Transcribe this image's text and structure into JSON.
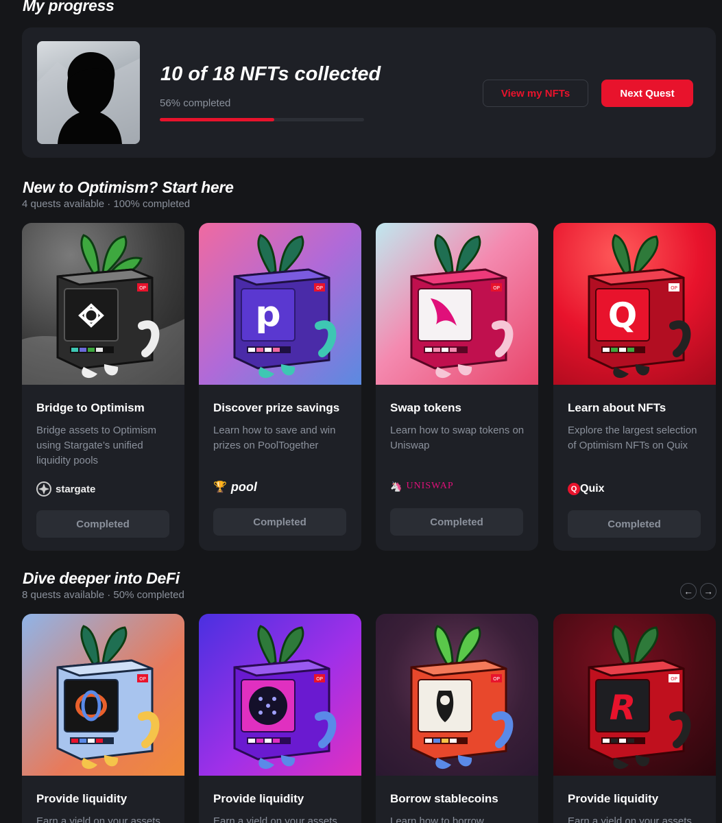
{
  "progress": {
    "heading": "My progress",
    "title": "10 of 18 NFTs collected",
    "completed_label": "56% completed",
    "percent": 0.56,
    "view_button": "View my NFTs",
    "next_button": "Next Quest"
  },
  "section1": {
    "heading": "New to Optimism? Start here",
    "subtitle": "4 quests available · 100% completed",
    "cards": [
      {
        "title": "Bridge to Optimism",
        "desc": "Bridge assets to Optimism using Stargate’s unified liquidity pools",
        "brand": "stargate",
        "button": "Completed",
        "screen": "compass"
      },
      {
        "title": "Discover prize savings",
        "desc": "Learn how to save and win prizes on PoolTogether",
        "brand": "pool",
        "button": "Completed",
        "screen": "p"
      },
      {
        "title": "Swap tokens",
        "desc": "Learn how to swap tokens on Uniswap",
        "brand": "UNISWAP",
        "button": "Completed",
        "screen": "unicorn"
      },
      {
        "title": "Learn about NFTs",
        "desc": "Explore the largest selection of Optimism NFTs on Quix",
        "brand": "Quix",
        "button": "Completed",
        "screen": "Q"
      }
    ]
  },
  "section2": {
    "heading": "Dive deeper into DeFi",
    "subtitle": "8 quests available · 50% completed",
    "prev_icon": "←",
    "next_icon": "→",
    "cards": [
      {
        "title": "Provide liquidity",
        "desc": "Earn a yield on your assets",
        "screen": "loop"
      },
      {
        "title": "Provide liquidity",
        "desc": "Earn a yield on your assets",
        "screen": "circle"
      },
      {
        "title": "Borrow stablecoins",
        "desc": "Learn how to borrow",
        "screen": "face"
      },
      {
        "title": "Provide liquidity",
        "desc": "Earn a yield on your assets",
        "screen": "R"
      }
    ]
  },
  "robot_badge": "OP",
  "colors": {
    "accent": "#e8132c",
    "card": "#1e2026",
    "bg": "#151619",
    "muted": "#8b919c"
  }
}
